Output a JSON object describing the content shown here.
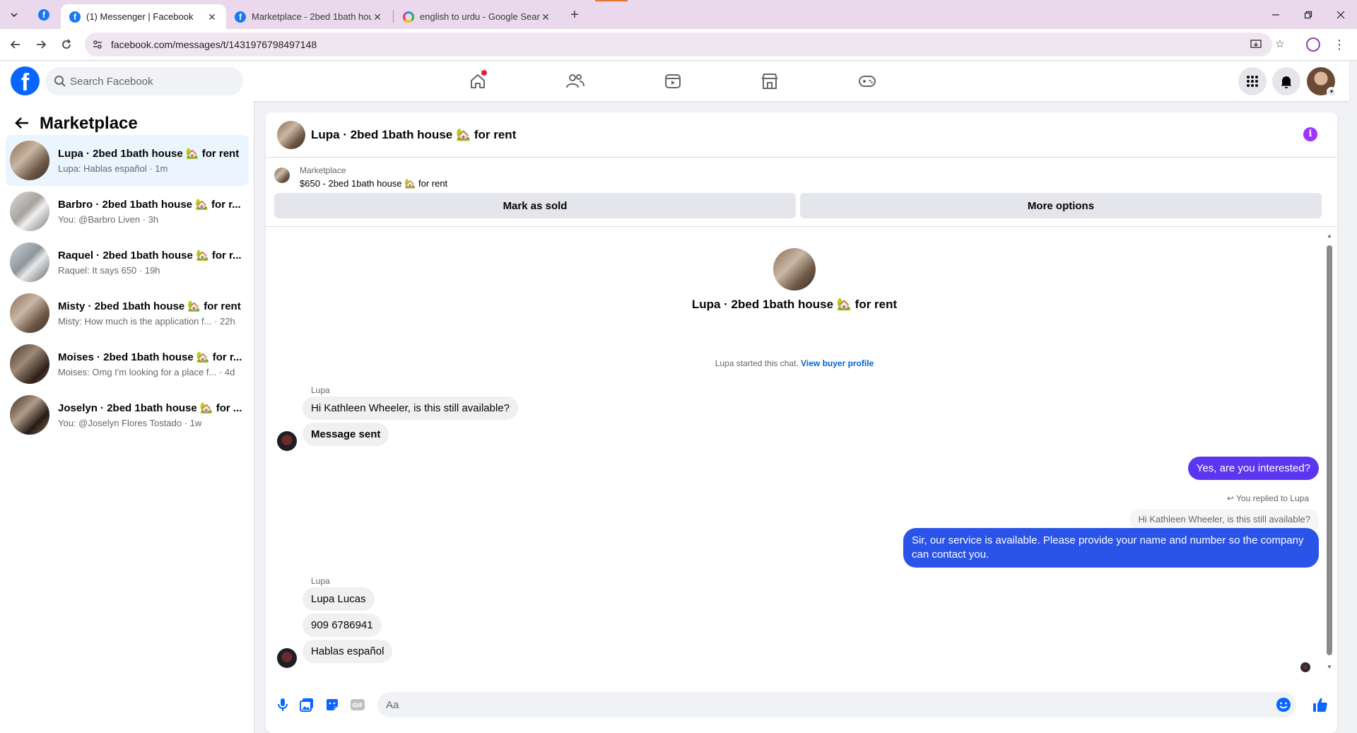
{
  "browser": {
    "tabs": [
      {
        "title": "(1) Messenger | Facebook",
        "favicon": "facebook-icon",
        "active": true
      },
      {
        "title": "Marketplace - 2bed 1bath hous",
        "favicon": "facebook-icon",
        "active": false
      },
      {
        "title": "english to urdu - Google Search",
        "favicon": "google-icon",
        "active": false
      }
    ],
    "url": "facebook.com/messages/t/1431976798497148"
  },
  "fb": {
    "search_placeholder": "Search Facebook",
    "brand_color": "#0866ff",
    "home_notification": true
  },
  "sidebar": {
    "title": "Marketplace",
    "conversations": [
      {
        "name": "Lupa · 2bed 1bath house 🏡 for rent",
        "preview": "Lupa: Hablas español · 1m",
        "active": true
      },
      {
        "name": "Barbro · 2bed 1bath house 🏡 for r...",
        "preview": "You: @Barbro Liven · 3h",
        "active": false
      },
      {
        "name": "Raquel · 2bed 1bath house 🏡 for r...",
        "preview": "Raquel: It says 650 · 19h",
        "active": false
      },
      {
        "name": "Misty · 2bed 1bath house 🏡 for rent",
        "preview": "Misty: How much is the application f... · 22h",
        "active": false
      },
      {
        "name": "Moises · 2bed 1bath house 🏡 for r...",
        "preview": "Moises: Omg I'm looking for a place f... · 4d",
        "active": false
      },
      {
        "name": "Joselyn · 2bed 1bath house 🏡 for ...",
        "preview": "You: @Joselyn Flores Tostado · 1w",
        "active": false
      }
    ]
  },
  "chat": {
    "title": "Lupa · 2bed 1bath house 🏡 for rent",
    "listing_source": "Marketplace",
    "listing_title": "$650 - 2bed 1bath house 🏡 for rent",
    "mark_sold_label": "Mark as sold",
    "more_options_label": "More options",
    "intro_name": "Lupa · 2bed 1bath house 🏡 for rent",
    "started_text": "Lupa started this chat.",
    "view_profile_label": "View buyer profile",
    "sender_name_1": "Lupa",
    "msg_1": "Hi Kathleen Wheeler, is this still available?",
    "msg_2": "Message sent",
    "reply_1": "Yes, are you interested?",
    "replied_note": "You replied to Lupa",
    "quoted": "Hi Kathleen Wheeler, is this still available?",
    "reply_2": "Sir, our service is available. Please provide your name and number so the company can contact you.",
    "sender_name_2": "Lupa",
    "msg_3": "Lupa Lucas",
    "msg_4": "909 6786941",
    "msg_5": "Hablas español",
    "composer_placeholder": "Aa",
    "outgoing_color": "#5b36f0",
    "outgoing_color_2": "#2a53e8"
  }
}
